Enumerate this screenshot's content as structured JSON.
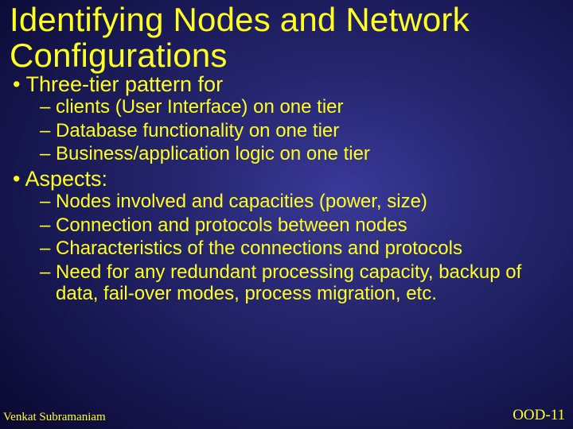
{
  "title": "Identifying Nodes and Network Configurations",
  "bullets": {
    "b1": "• Three-tier pattern for",
    "b1_subs": {
      "s1": "– clients (User Interface) on one tier",
      "s2": "– Database functionality on one tier",
      "s3": "– Business/application logic on one tier"
    },
    "b2": "• Aspects:",
    "b2_subs": {
      "s1": "– Nodes involved and capacities (power, size)",
      "s2": "– Connection and protocols between nodes",
      "s3": "– Characteristics of the connections and protocols",
      "s4": "– Need for any redundant processing capacity, backup of data, fail-over modes, process migration, etc."
    }
  },
  "footer": {
    "author": "Venkat Subramaniam",
    "pagenum": "OOD-11"
  }
}
